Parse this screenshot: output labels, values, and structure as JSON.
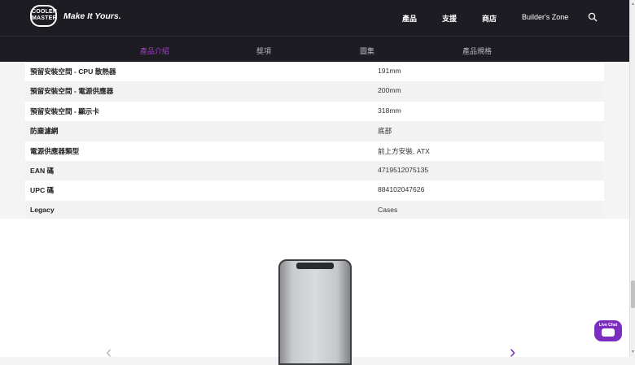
{
  "brand": {
    "logo_text": "COOLER MASTER",
    "tagline": "Make It Yours."
  },
  "nav": {
    "items": [
      {
        "label": "產品"
      },
      {
        "label": "支援"
      },
      {
        "label": "商店"
      },
      {
        "label": "Builder's Zone"
      }
    ]
  },
  "tabs": [
    {
      "label": "產品介紹",
      "active": true
    },
    {
      "label": "獎項"
    },
    {
      "label": "圖集"
    },
    {
      "label": "產品規格"
    }
  ],
  "specs": [
    {
      "label": "預留安裝空間 - CPU 散熱器",
      "value": "191mm"
    },
    {
      "label": "預留安裝空間 - 電源供應器",
      "value": "200mm"
    },
    {
      "label": "預留安裝空間 - 顯示卡",
      "value": "318mm"
    },
    {
      "label": "防塵濾網",
      "value": "底部"
    },
    {
      "label": "電源供應器類型",
      "value": "前上方安裝, ATX"
    },
    {
      "label": "EAN 碼",
      "value": "4719512075135"
    },
    {
      "label": "UPC 碼",
      "value": "884102047626"
    },
    {
      "label": "Legacy",
      "value": "Cases"
    }
  ],
  "chat": {
    "label": "Live Chat"
  },
  "colors": {
    "accent": "#9c3fc0",
    "header_bg": "#1c1c22",
    "chat_bg": "#7a2ec0"
  }
}
